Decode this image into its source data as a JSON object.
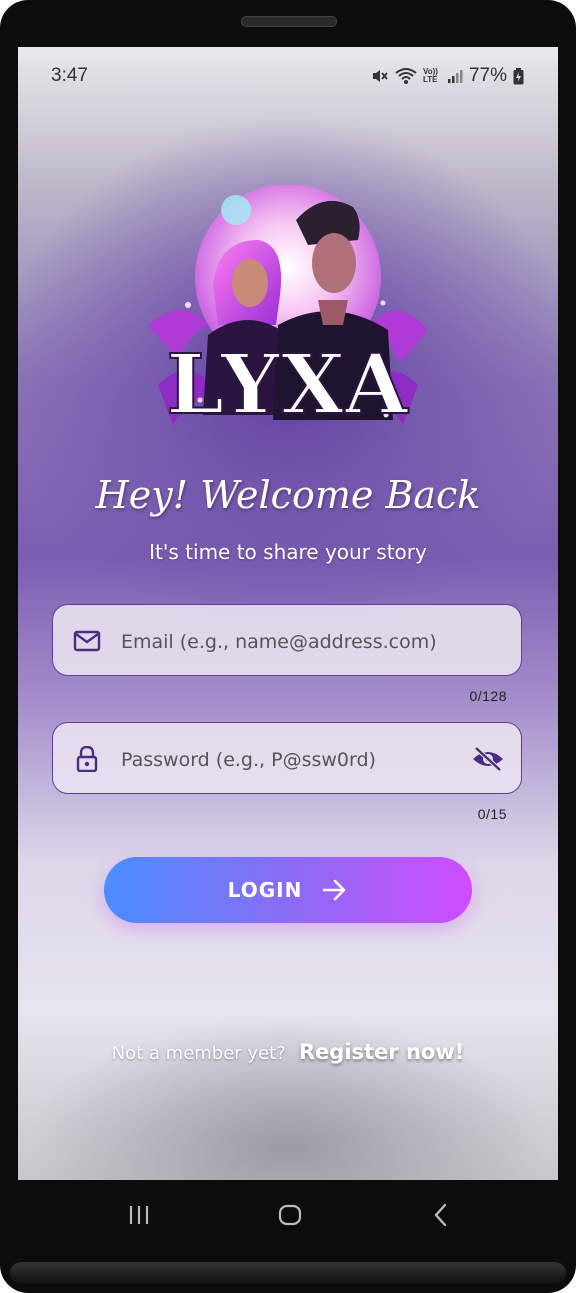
{
  "status_bar": {
    "time": "3:47",
    "battery": "77%",
    "volte": "Vo)) LTE"
  },
  "app": {
    "logo_text": "LYXA",
    "welcome": "Hey! Welcome Back",
    "subtitle": "It's time to share your story"
  },
  "form": {
    "email": {
      "value": "",
      "placeholder": "Email (e.g., name@address.com)",
      "counter": "0/128"
    },
    "password": {
      "value": "",
      "placeholder": "Password (e.g., P@ssw0rd)",
      "counter": "0/15"
    },
    "login_label": "LOGIN"
  },
  "footer": {
    "question": "Not a member yet?",
    "register_label": "Register now!"
  },
  "colors": {
    "accent_purple": "#5c3f99",
    "button_start": "#4b8cff",
    "button_end": "#cf4cff"
  },
  "icons": [
    "mute-icon",
    "wifi-icon",
    "signal-icon",
    "battery-icon",
    "mail-icon",
    "lock-icon",
    "eye-off-icon",
    "arrow-right-icon",
    "recent-apps-icon",
    "home-icon",
    "back-icon"
  ]
}
